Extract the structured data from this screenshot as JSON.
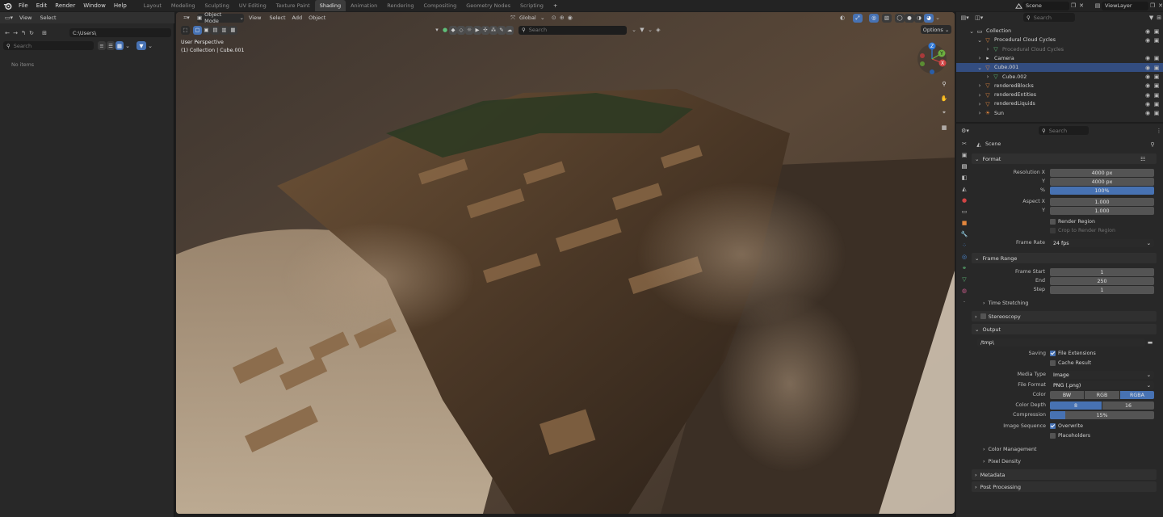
{
  "menu": [
    "File",
    "Edit",
    "Render",
    "Window",
    "Help"
  ],
  "workspaces": [
    "Layout",
    "Modeling",
    "Sculpting",
    "UV Editing",
    "Texture Paint",
    "Shading",
    "Animation",
    "Rendering",
    "Compositing",
    "Geometry Nodes",
    "Scripting"
  ],
  "active_workspace": "Shading",
  "add_tab": "+",
  "scene_name": "Scene",
  "view_layer": "ViewLayer",
  "file_browser": {
    "view": "View",
    "select": "Select",
    "path": "C:\\Users\\",
    "search_placeholder": "Search",
    "empty": "No items"
  },
  "viewport": {
    "mode": "Object Mode",
    "menus": [
      "View",
      "Select",
      "Add",
      "Object"
    ],
    "orientation": "Global",
    "search_placeholder": "Search",
    "options": "Options",
    "overlay_line1": "User Perspective",
    "overlay_line2": "(1) Collection | Cube.001",
    "gizmo": {
      "z": "Z",
      "y": "Y",
      "x": "X"
    }
  },
  "outliner": {
    "search_placeholder": "Search",
    "items": [
      {
        "label": "Collection",
        "indent": 0
      },
      {
        "label": "Procedural Cloud Cycles",
        "indent": 1
      },
      {
        "label": "Procedural Cloud Cycles",
        "indent": 2,
        "dim": true
      },
      {
        "label": "Camera",
        "indent": 1
      },
      {
        "label": "Cube.001",
        "indent": 1
      },
      {
        "label": "Cube.002",
        "indent": 2
      },
      {
        "label": "renderedBlocks",
        "indent": 1
      },
      {
        "label": "renderedEntities",
        "indent": 1
      },
      {
        "label": "renderedLiquids",
        "indent": 1
      },
      {
        "label": "Sun",
        "indent": 1
      }
    ]
  },
  "properties": {
    "search_placeholder": "Search",
    "scene_label": "Scene",
    "format": {
      "title": "Format",
      "res_x_label": "Resolution X",
      "res_x": "4000 px",
      "res_y_label": "Y",
      "res_y": "4000 px",
      "pct_label": "%",
      "pct": "100%",
      "aspect_x_label": "Aspect X",
      "aspect_x": "1.000",
      "aspect_y_label": "Y",
      "aspect_y": "1.000",
      "render_region": "Render Region",
      "crop": "Crop to Render Region",
      "frame_rate_label": "Frame Rate",
      "frame_rate": "24 fps"
    },
    "frame_range": {
      "title": "Frame Range",
      "start_label": "Frame Start",
      "start": "1",
      "end_label": "End",
      "end": "250",
      "step_label": "Step",
      "step": "1",
      "time_stretching": "Time Stretching"
    },
    "stereoscopy": "Stereoscopy",
    "output": {
      "title": "Output",
      "path": "/tmp\\",
      "saving_label": "Saving",
      "file_extensions": "File Extensions",
      "cache_result": "Cache Result",
      "media_type_label": "Media Type",
      "media_type": "Image",
      "file_format_label": "File Format",
      "file_format": "PNG (.png)",
      "color_label": "Color",
      "color_opts": [
        "BW",
        "RGB",
        "RGBA"
      ],
      "depth_label": "Color Depth",
      "depth_opts": [
        "8",
        "16"
      ],
      "compression_label": "Compression",
      "compression": "15%",
      "compression_value": 0.15,
      "seq_label": "Image Sequence",
      "overwrite": "Overwrite",
      "placeholders": "Placeholders",
      "color_management": "Color Management",
      "pixel_density": "Pixel Density"
    },
    "metadata": "Metadata",
    "post_processing": "Post Processing"
  },
  "colors": {
    "accent": "#4772b3",
    "panel": "#282828",
    "header": "#232323",
    "icon_orange": "#e3873d",
    "icon_green": "#5fbf7a"
  }
}
